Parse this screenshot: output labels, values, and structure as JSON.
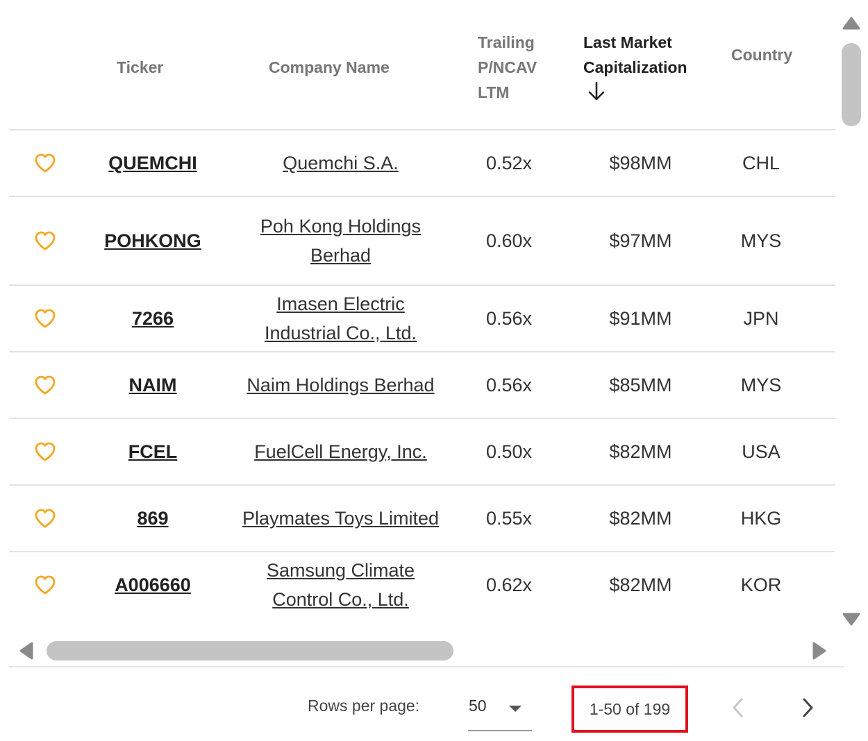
{
  "header": {
    "ticker": "Ticker",
    "company": "Company Name",
    "pncav_lines": [
      "Trailing",
      "P/NCAV",
      "LTM"
    ],
    "mcap_lines": [
      "Last Market",
      "Capitalization"
    ],
    "country": "Country"
  },
  "rows": [
    {
      "ticker": "QUEMCHI",
      "company": "Quemchi S.A.",
      "pncav": "0.52x",
      "mcap": "$98MM",
      "country": "CHL"
    },
    {
      "ticker": "POHKONG",
      "company": "Poh Kong Holdings Berhad",
      "pncav": "0.60x",
      "mcap": "$97MM",
      "country": "MYS"
    },
    {
      "ticker": "7266",
      "company": "Imasen Electric Industrial Co., Ltd.",
      "pncav": "0.56x",
      "mcap": "$91MM",
      "country": "JPN"
    },
    {
      "ticker": "NAIM",
      "company": "Naim Holdings Berhad",
      "pncav": "0.56x",
      "mcap": "$85MM",
      "country": "MYS"
    },
    {
      "ticker": "FCEL",
      "company": "FuelCell Energy, Inc.",
      "pncav": "0.50x",
      "mcap": "$82MM",
      "country": "USA"
    },
    {
      "ticker": "869",
      "company": "Playmates Toys Limited",
      "pncav": "0.55x",
      "mcap": "$82MM",
      "country": "HKG"
    },
    {
      "ticker": "A006660",
      "company": "Samsung Climate Control Co., Ltd.",
      "pncav": "0.62x",
      "mcap": "$82MM",
      "country": "KOR"
    }
  ],
  "pagination": {
    "rows_per_page_label": "Rows per page:",
    "rows_per_page": "50",
    "range": "1-50 of 199"
  },
  "colors": {
    "favorite_icon": "#f5a623",
    "highlight_box": "#e0101e",
    "scrollbar": "#c4c4c4"
  },
  "icons": {
    "favorite": "heart-outline-icon",
    "sort": "arrow-down-icon",
    "rows_select": "caret-down-icon",
    "prev": "chevron-left-icon",
    "next": "chevron-right-icon"
  }
}
